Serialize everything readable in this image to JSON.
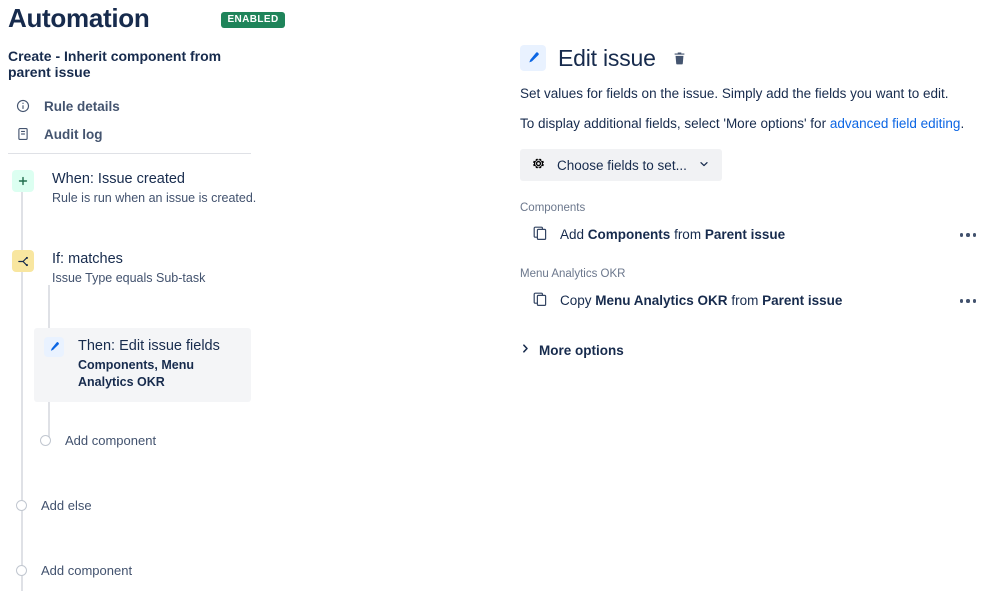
{
  "header": {
    "title": "Automation",
    "status_badge": "ENABLED",
    "badge_color": "#1f845a",
    "rule_name": "Create - Inherit component from parent issue"
  },
  "sidebar": {
    "nav": [
      {
        "label": "Rule details",
        "icon": "info-icon"
      },
      {
        "label": "Audit log",
        "icon": "audit-log-icon"
      }
    ],
    "tree": {
      "when": {
        "title": "When: Issue created",
        "subtitle": "Rule is run when an issue is created.",
        "icon": "plus-icon"
      },
      "if": {
        "title": "If: matches",
        "subtitle": "Issue Type equals Sub-task",
        "icon": "branch-icon"
      },
      "then": {
        "title": "Then: Edit issue fields",
        "subtitle": "Components, Menu Analytics OKR",
        "icon": "pencil-icon"
      },
      "add_component_inner": "Add component",
      "add_else": "Add else",
      "add_component_outer": "Add component"
    }
  },
  "panel": {
    "icon": "pencil-icon",
    "title": "Edit issue",
    "delete_icon": "trash-icon",
    "description_1": "Set values for fields on the issue. Simply add the fields you want to edit.",
    "description_2_prefix": "To display additional fields, select 'More options' for ",
    "description_2_link": "advanced field editing",
    "description_2_suffix": ".",
    "link_color": "#0c66e4",
    "choose_fields_button": "Choose fields to set...",
    "choose_fields_icon": "gear-icon",
    "fields": [
      {
        "label": "Components",
        "action": "Add",
        "field_name": "Components",
        "connector": "from",
        "source": "Parent issue",
        "icon": "copy-icon",
        "menu": "more-menu-icon"
      },
      {
        "label": "Menu Analytics OKR",
        "action": "Copy",
        "field_name": "Menu Analytics OKR",
        "connector": "from",
        "source": "Parent issue",
        "icon": "copy-icon",
        "menu": "more-menu-icon"
      }
    ],
    "more_options": "More options",
    "more_options_icon": "chevron-right-icon"
  }
}
